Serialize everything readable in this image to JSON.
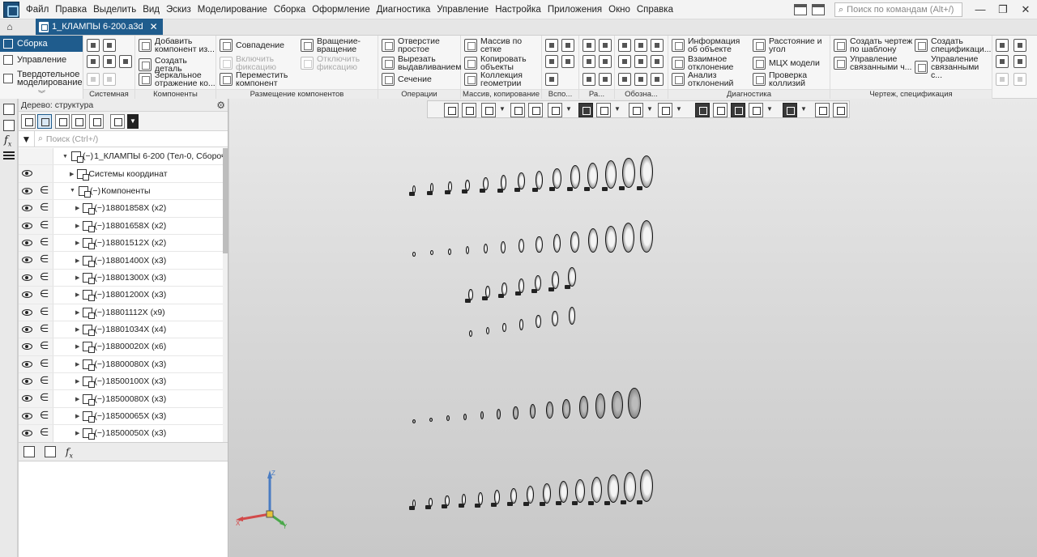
{
  "menubar": {
    "items": [
      "Файл",
      "Правка",
      "Выделить",
      "Вид",
      "Эскиз",
      "Моделирование",
      "Сборка",
      "Оформление",
      "Диагностика",
      "Управление",
      "Настройка",
      "Приложения",
      "Окно",
      "Справка"
    ],
    "search_placeholder": "Поиск по командам (Alt+/)"
  },
  "tabs": {
    "document": "1_КЛАМПЫ 6-200.a3d",
    "close": "✕"
  },
  "ribbon": {
    "modes": [
      "Сборка",
      "Управление",
      "Твердотельное моделирование"
    ],
    "groups": {
      "system": "Системная",
      "components": "Компоненты",
      "placement": "Размещение компонентов",
      "operations": "Операции",
      "array": "Массив, копирование",
      "aux": "Вспо...",
      "ra": "Ра...",
      "marks": "Обозна...",
      "diag": "Диагностика",
      "drawing": "Чертеж, спецификация"
    },
    "buttons": {
      "add_component": "Добавить компонент из...",
      "create_part": "Создать деталь",
      "mirror": "Зеркальное отражение ко...",
      "coincidence": "Совпадение",
      "enable_fix": "Включить фиксацию",
      "move_component": "Переместить компонент",
      "rotate": "Вращение-вращение",
      "disable_fix": "Отключить фиксацию",
      "hole": "Отверстие простое",
      "extrude_cut": "Вырезать выдавливанием",
      "section": "Сечение",
      "grid_array": "Массив по сетке",
      "copy_objects": "Копировать объекты",
      "geom_collection": "Коллекция геометрии",
      "object_info": "Информация об объекте",
      "mutual_deviation": "Взаимное отклонение",
      "deviation_analysis": "Анализ отклонений",
      "distance_angle": "Расстояние и угол",
      "mass_props": "МЦХ модели",
      "collision_check": "Проверка коллизий",
      "template_drawing": "Создать чертеж по шаблону",
      "linked_drawing": "Управление связанными ч...",
      "create_spec": "Создать спецификаци...",
      "linked_spec": "Управление связанными с..."
    }
  },
  "tree": {
    "title": "Дерево: структура",
    "search_placeholder": "Поиск (Ctrl+/)",
    "root": "1_КЛАМПЫ 6-200 (Тел-0, Сборочни",
    "coord_systems": "Системы координат",
    "components": "Компоненты",
    "items": [
      {
        "name": "18801858X (x2)"
      },
      {
        "name": "18801658X (x2)"
      },
      {
        "name": "18801512X (x2)"
      },
      {
        "name": "18801400X (x3)"
      },
      {
        "name": "18801300X (x3)"
      },
      {
        "name": "18801200X (x3)"
      },
      {
        "name": "18801112X (x9)"
      },
      {
        "name": "18801034X (x4)"
      },
      {
        "name": "18800020X (x6)"
      },
      {
        "name": "18800080X (x3)"
      },
      {
        "name": "18500100X (x3)"
      },
      {
        "name": "18500080X (x3)"
      },
      {
        "name": "18500065X (x3)"
      },
      {
        "name": "18500050X (x3)"
      }
    ]
  },
  "triad": {
    "x": "X",
    "y": "Y",
    "z": "Z"
  },
  "colors": {
    "accent": "#1f5c8d",
    "viewport_top": "#e9e9e9",
    "viewport_bottom": "#c8c8c8"
  }
}
